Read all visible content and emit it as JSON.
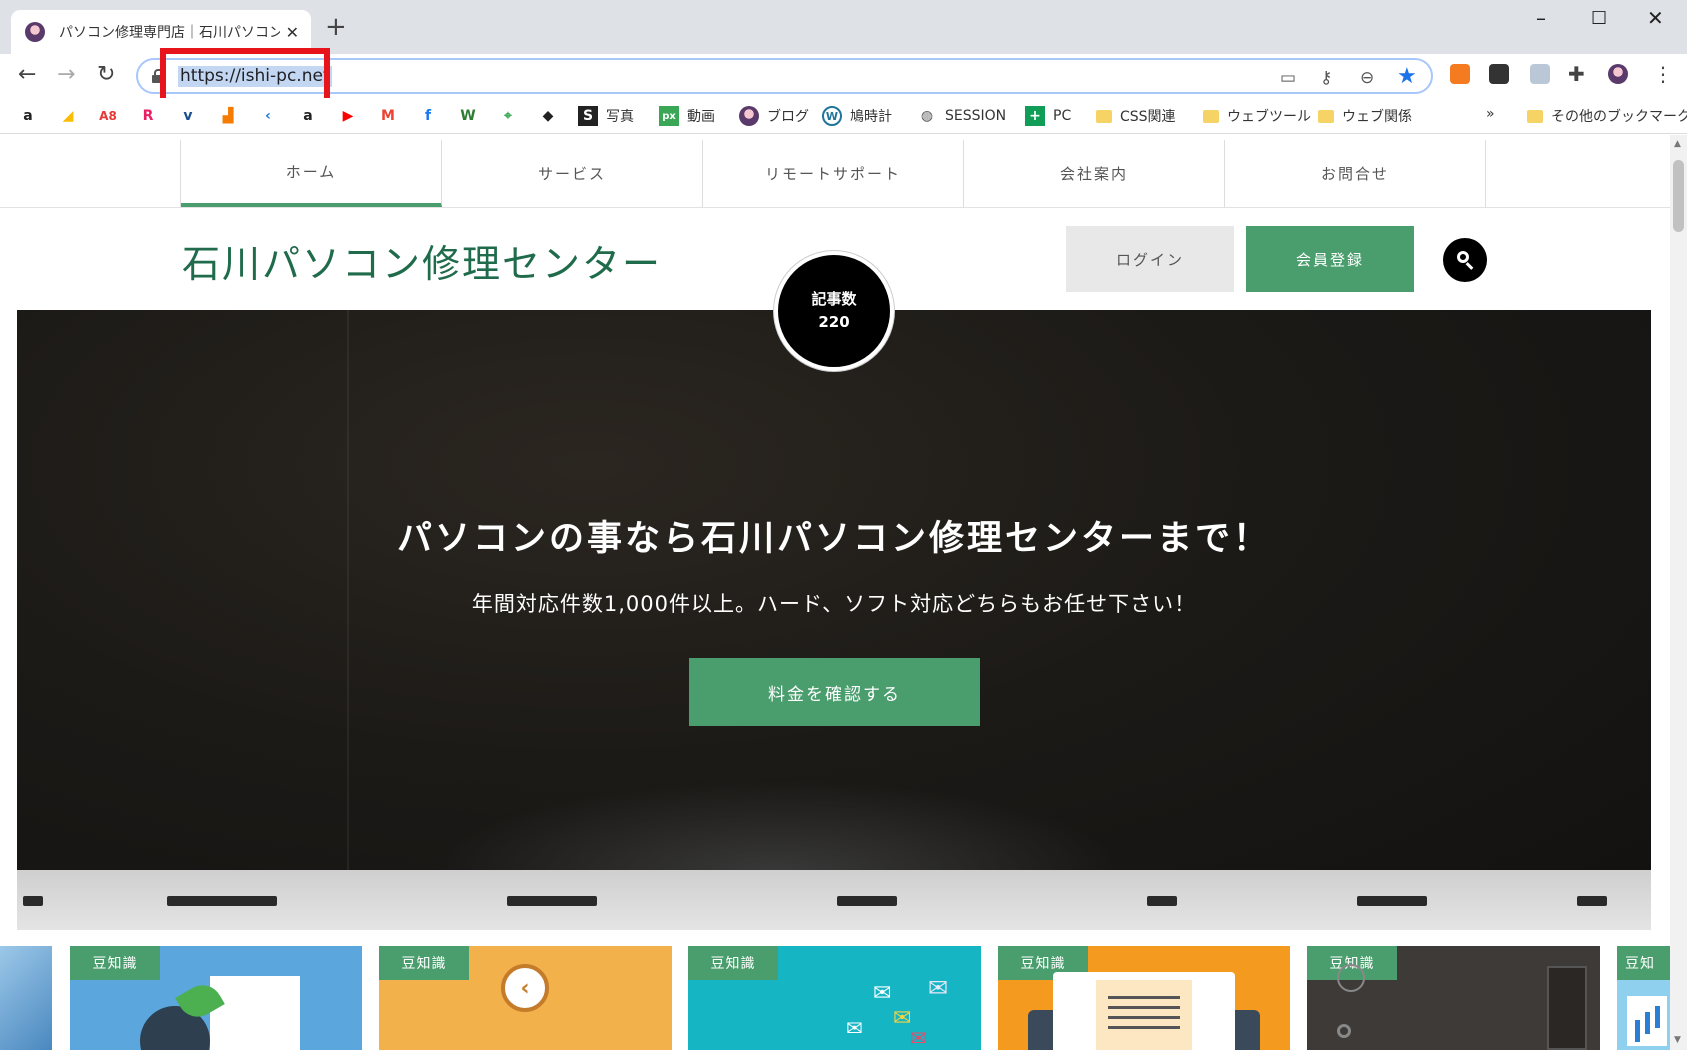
{
  "browser": {
    "tab_title": "パソコン修理専門店｜石川パソコン修",
    "url": "https://ishi-pc.net",
    "bookmarks": [
      {
        "icon": "amazon-icon",
        "label": ""
      },
      {
        "icon": "google-ads-icon",
        "label": ""
      },
      {
        "icon": "a8-icon",
        "label": ""
      },
      {
        "icon": "rakuten-icon",
        "label": ""
      },
      {
        "icon": "valuecommerce-icon",
        "label": ""
      },
      {
        "icon": "analytics-icon",
        "label": ""
      },
      {
        "icon": "feedly-icon",
        "label": ""
      },
      {
        "icon": "amazon-icon",
        "label": ""
      },
      {
        "icon": "youtube-icon",
        "label": ""
      },
      {
        "icon": "gmail-icon",
        "label": ""
      },
      {
        "icon": "facebook-icon",
        "label": ""
      },
      {
        "icon": "hatena-icon",
        "label": ""
      },
      {
        "icon": "maps-icon",
        "label": ""
      },
      {
        "icon": "diamond-icon",
        "label": ""
      },
      {
        "icon": "s-icon",
        "label": "写真"
      },
      {
        "icon": "px-icon",
        "label": "動画"
      },
      {
        "icon": "avatar-icon",
        "label": "ブログ"
      },
      {
        "icon": "wordpress-icon",
        "label": "鳩時計"
      },
      {
        "icon": "globe-icon",
        "label": "SESSION"
      },
      {
        "icon": "plus-icon",
        "label": "PC"
      },
      {
        "icon": "folder-icon",
        "label": "CSS関連"
      },
      {
        "icon": "folder-icon",
        "label": "ウェブツール"
      },
      {
        "icon": "folder-icon",
        "label": "ウェブ関係"
      }
    ],
    "more_bookmarks": "»",
    "other_bookmarks": "その他のブックマーク"
  },
  "site": {
    "nav": [
      "ホーム",
      "サービス",
      "リモートサポート",
      "会社案内",
      "お問合せ"
    ],
    "title": "石川パソコン修理センター",
    "login": "ログイン",
    "signup": "会員登録",
    "post_count_label": "記事数",
    "post_count": "220",
    "hero_heading": "パソコンの事なら石川パソコン修理センターまで！",
    "hero_sub": "年間対応件数1,000件以上。ハード、ソフト対応どちらもお任せ下さい！",
    "hero_cta": "料金を確認する",
    "card_badge": "豆知識",
    "cards": [
      {
        "badge": "豆知識",
        "color": "#5aa6dd"
      },
      {
        "badge": "豆知識",
        "color": "#f2b14b"
      },
      {
        "badge": "豆知識",
        "color": "#16b5c4"
      },
      {
        "badge": "豆知識",
        "color": "#f39a1f"
      },
      {
        "badge": "豆知識",
        "color": "#3d3a38"
      },
      {
        "badge": "豆知",
        "color": "#8fd0ef"
      }
    ]
  },
  "colors": {
    "accent_green": "#4a9e6e",
    "title_green": "#1f6b4b",
    "highlight_red": "#e8141c"
  }
}
